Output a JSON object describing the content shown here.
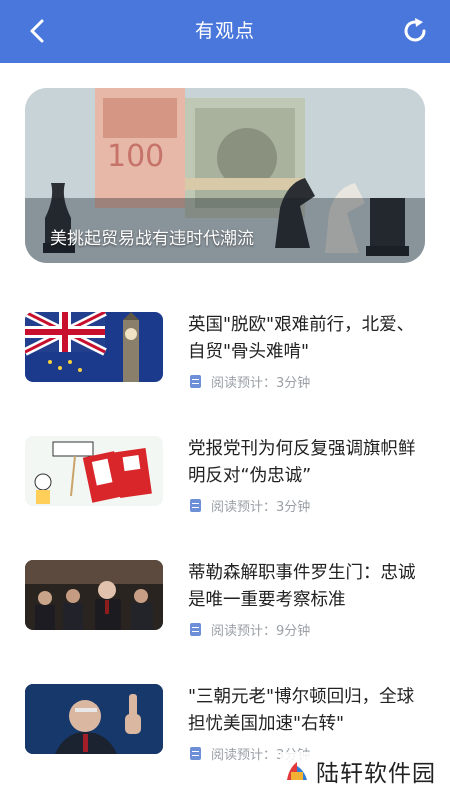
{
  "header": {
    "title": "有观点",
    "back_icon": "back-chevron-icon",
    "refresh_icon": "refresh-icon",
    "bg_color": "#4a77dc"
  },
  "hero": {
    "caption": "美挑起贸易战有违时代潮流",
    "image": "currency-and-chess-image"
  },
  "articles": [
    {
      "headline": "英国\"脱欧\"艰难前行，北爱、自贸\"骨头难啃\"",
      "read_time": "阅读预计：3分钟",
      "image": "uk-eu-flags-big-ben-image"
    },
    {
      "headline": "党报党刊为何反复强调旗帜鲜明反对“伪忠诚”",
      "read_time": "阅读预计：3分钟",
      "image": "cartoon-image"
    },
    {
      "headline": "蒂勒森解职事件罗生门：忠诚是唯一重要考察标准",
      "read_time": "阅读预计：9分钟",
      "image": "meeting-photo-image"
    },
    {
      "headline": "\"三朝元老\"博尔顿回归，全球担忧美国加速\"右转\"",
      "read_time": "阅读预计：3分钟",
      "image": "speaker-photo-image"
    }
  ],
  "watermark": {
    "text": "陆轩软件园"
  }
}
